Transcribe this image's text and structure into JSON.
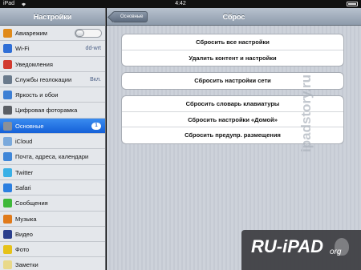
{
  "statusbar": {
    "device": "iPad",
    "time": "4:42"
  },
  "sidebar": {
    "title": "Настройки",
    "items": [
      {
        "label": "Авиарежим",
        "icon": "airplane-icon",
        "color": "#e08a1a",
        "toggle": "off"
      },
      {
        "label": "Wi-Fi",
        "icon": "wifi-icon",
        "color": "#2f6fd6",
        "value": "dd-wrt"
      },
      {
        "label": "Уведомления",
        "icon": "notifications-icon",
        "color": "#d23a2f"
      },
      {
        "label": "Службы геолокации",
        "icon": "location-icon",
        "color": "#6a7a8c",
        "value": "Вкл."
      },
      {
        "label": "Яркость и обои",
        "icon": "brightness-icon",
        "color": "#3d7fd4"
      },
      {
        "label": "Цифровая фоторамка",
        "icon": "photo-frame-icon",
        "color": "#5a5e64"
      },
      {
        "label": "Основные",
        "icon": "gear-icon",
        "color": "#8a9098",
        "badge": "1",
        "selected": true
      },
      {
        "label": "iCloud",
        "icon": "cloud-icon",
        "color": "#7aa9dc"
      },
      {
        "label": "Почта, адреса, календари",
        "icon": "mail-icon",
        "color": "#3f86d8"
      },
      {
        "label": "Twitter",
        "icon": "twitter-icon",
        "color": "#3ab0e6"
      },
      {
        "label": "Safari",
        "icon": "safari-icon",
        "color": "#2c7fe0"
      },
      {
        "label": "Сообщения",
        "icon": "messages-icon",
        "color": "#3fb83a"
      },
      {
        "label": "Музыка",
        "icon": "music-icon",
        "color": "#e07a1a"
      },
      {
        "label": "Видео",
        "icon": "video-icon",
        "color": "#2a3e8c"
      },
      {
        "label": "Фото",
        "icon": "photos-icon",
        "color": "#e6c21a"
      },
      {
        "label": "Заметки",
        "icon": "notes-icon",
        "color": "#e9d98a"
      }
    ]
  },
  "main": {
    "title": "Сброс",
    "back_label": "Основные",
    "group1": [
      "Сбросить все настройки",
      "Удалить контент и настройки"
    ],
    "group2": [
      "Сбросить настройки сети"
    ],
    "group3": [
      "Сбросить словарь клавиатуры",
      "Сбросить настройки «Домой»",
      "Сбросить предупр. размещения"
    ]
  },
  "watermark": {
    "side_text": "ipadstory.ru",
    "logo_text": "RU-iPAD",
    "logo_suffix": "org"
  }
}
